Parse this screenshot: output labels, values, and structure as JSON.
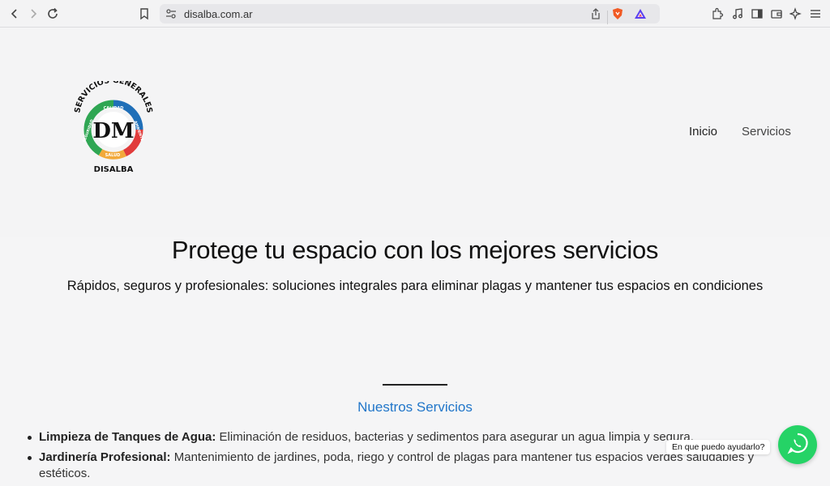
{
  "browser": {
    "url": "disalba.com.ar",
    "icons": [
      "back-icon",
      "forward-icon",
      "reload-icon",
      "bookmark-icon",
      "site-settings-icon",
      "share-icon",
      "brave-shield-icon",
      "brave-rewards-icon",
      "extensions-icon",
      "media-icon",
      "sidebar-icon",
      "wallet-icon",
      "leo-ai-icon",
      "menu-icon"
    ]
  },
  "header": {
    "logo": {
      "top_text": "SERVICIOS GENERALES",
      "ring_labels": [
        "CALIDAD",
        "AMBIENTE",
        "SALUD",
        "SEGURIDAD"
      ],
      "monogram": "DM",
      "bottom_text": "DISALBA",
      "colors": {
        "blue": "#1f6fb8",
        "red": "#e13b3b",
        "orange": "#f2a93b",
        "green": "#2fa653"
      }
    },
    "nav": [
      {
        "label": "Inicio"
      },
      {
        "label": "Servicios"
      }
    ]
  },
  "hero": {
    "title": "Protege tu espacio con los mejores servicios",
    "subtitle": "Rápidos, seguros y profesionales: soluciones integrales para eliminar plagas y mantener tus espacios en condiciones"
  },
  "services": {
    "title": "Nuestros Servicios",
    "accent_color": "#2176c9",
    "items": [
      {
        "name": "Limpieza de Tanques de Agua:",
        "desc": " Eliminación de residuos, bacterias y sedimentos para asegurar un agua limpia y segura."
      },
      {
        "name": "Jardinería Profesional:",
        "desc": " Mantenimiento de jardines, poda, riego y control de plagas para mantener tus espacios verdes saludables y estéticos."
      }
    ]
  },
  "chat": {
    "bubble_text": "En que puedo ayudarlo?",
    "button_icon": "whatsapp-icon",
    "button_color": "#25d366"
  }
}
